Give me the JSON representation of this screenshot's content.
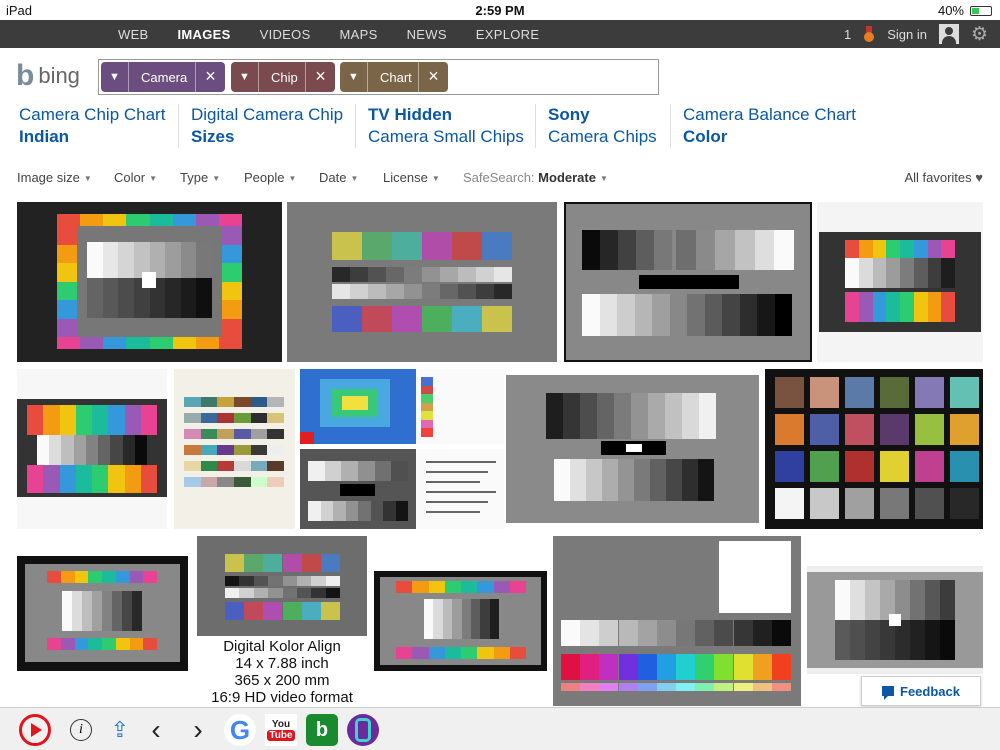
{
  "status_bar": {
    "device": "iPad",
    "time": "2:59 PM",
    "battery": "40%",
    "battery_level": 0.4
  },
  "top_nav": {
    "tabs": [
      {
        "label": "WEB",
        "active": false
      },
      {
        "label": "IMAGES",
        "active": true
      },
      {
        "label": "VIDEOS",
        "active": false
      },
      {
        "label": "MAPS",
        "active": false
      },
      {
        "label": "NEWS",
        "active": false
      },
      {
        "label": "EXPLORE",
        "active": false
      }
    ],
    "rewards_count": "1",
    "sign_in": "Sign in"
  },
  "logo": {
    "text": "bing"
  },
  "search": {
    "chips": [
      {
        "label": "Camera",
        "color": "#6b4e7f"
      },
      {
        "label": "Chip",
        "color": "#7a4a4e"
      },
      {
        "label": "Chart",
        "color": "#7a6548"
      }
    ]
  },
  "related_searches": [
    {
      "line1": "Camera Chip Chart",
      "line2": "Indian",
      "bold_line": 2
    },
    {
      "line1": "Digital Camera Chip",
      "line2": "Sizes",
      "bold_line": 2
    },
    {
      "line1": "TV Hidden",
      "line2": "Camera Small Chips",
      "bold_line": 1
    },
    {
      "line1": "Sony",
      "line2": "Camera Chips",
      "bold_line": 1
    },
    {
      "line1": "Camera Balance Chart",
      "line2": "Color",
      "bold_line": 2
    }
  ],
  "filters": {
    "items": [
      "Image size",
      "Color",
      "Type",
      "People",
      "Date",
      "License"
    ],
    "safesearch_label": "SafeSearch:",
    "safesearch_value": "Moderate",
    "favorites": "All favorites"
  },
  "image_captions": {
    "kolor": [
      "Digital Kolor Align",
      "14 x 7.88 inch",
      "365 x 200 mm",
      "16:9 HD video format"
    ]
  },
  "feedback": {
    "label": "Feedback"
  },
  "toolbar": {
    "info_label": "i",
    "google_label": "G",
    "yt_you": "You",
    "yt_tube": "Tube",
    "bing_label": "b"
  }
}
